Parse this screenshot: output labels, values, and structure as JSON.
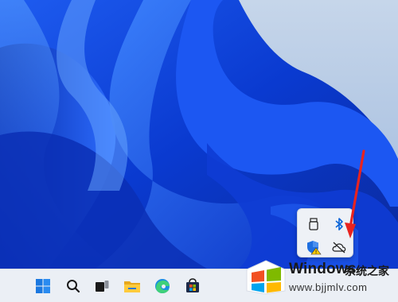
{
  "taskbar": {
    "icons": [
      "windows-start-icon",
      "search-icon",
      "task-view-icon",
      "file-explorer-icon",
      "edge-icon",
      "microsoft-store-icon"
    ]
  },
  "tray_overflow": {
    "icons": [
      "usb-drive-icon",
      "bluetooth-icon",
      "windows-security-warning-icon",
      "cloud-offline-icon"
    ]
  },
  "watermark": {
    "brand": "Windows",
    "title": "系统之家",
    "url": "www.bjjmlv.com"
  },
  "colors": {
    "accent_red": "#e8231f",
    "wallpaper_blue": "#0b3fc8",
    "taskbar_bg": "#ebeff5"
  }
}
